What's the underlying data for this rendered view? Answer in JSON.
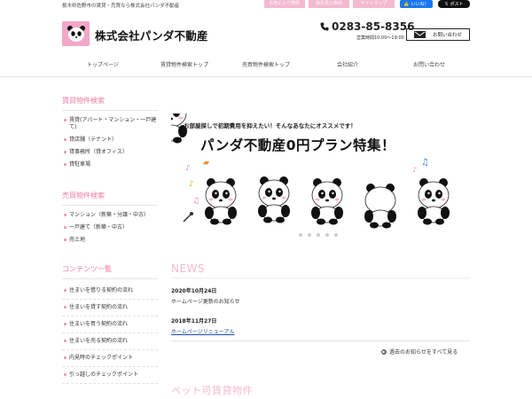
{
  "header": {
    "tagline": "栃木県佐野市の賃貸・売買なら株式会社パンダ不動産",
    "top_links": [
      "お気に入り物件",
      "最近見た物件",
      "サイトマップ"
    ],
    "fb_like": "いいね！",
    "x_post": "ポスト",
    "company_name": "株式会社パンダ不動産",
    "phone": "0283-85-8356",
    "hours": "営業時間10:00～19:00",
    "contact_label": "お問い合わせ"
  },
  "nav": [
    "トップページ",
    "賃貸物件検索トップ",
    "売買物件検索トップ",
    "会社紹介",
    "お問い合わせ"
  ],
  "sidebar": {
    "rental": {
      "heading": "賃貸物件検索",
      "items": [
        "賃貸(アパート・マンション・一戸建て)",
        "貸店舗（テナント）",
        "貸事務所（貸オフィス）",
        "貸駐車場"
      ]
    },
    "sale": {
      "heading": "売買物件検索",
      "items": [
        "マンション（新築・分譲・中古）",
        "一戸建て（新築・中古）",
        "売土地"
      ]
    },
    "contents": {
      "heading": "コンテンツ一覧",
      "items": [
        "住まいを借りる契約の流れ",
        "住まいを貸す契約の流れ",
        "住まいを買う契約の流れ",
        "住まいを売る契約の流れ",
        "内見時のチェックポイント",
        "引っ越しのチェックポイント"
      ]
    }
  },
  "banner": {
    "subheading": "お部屋探しで初期費用を抑えたい！そんなあなたにオススメです！",
    "heading": "パンダ不動産0円プラン特集！"
  },
  "news": {
    "heading": "NEWS",
    "items": [
      {
        "date": "2020年10月24日",
        "title": "ホームページ更新のお知らせ"
      },
      {
        "date": "2018年11月27日",
        "title": "ホームページリニューアル"
      }
    ],
    "all_label": "過去のお知らせをすべて見る"
  },
  "pet": {
    "heading": "ペット可賃貸物件"
  },
  "colors": {
    "accent_pink": "#f07ba7",
    "light_pink": "#f4b8cf",
    "link_blue": "#1a4da8"
  }
}
